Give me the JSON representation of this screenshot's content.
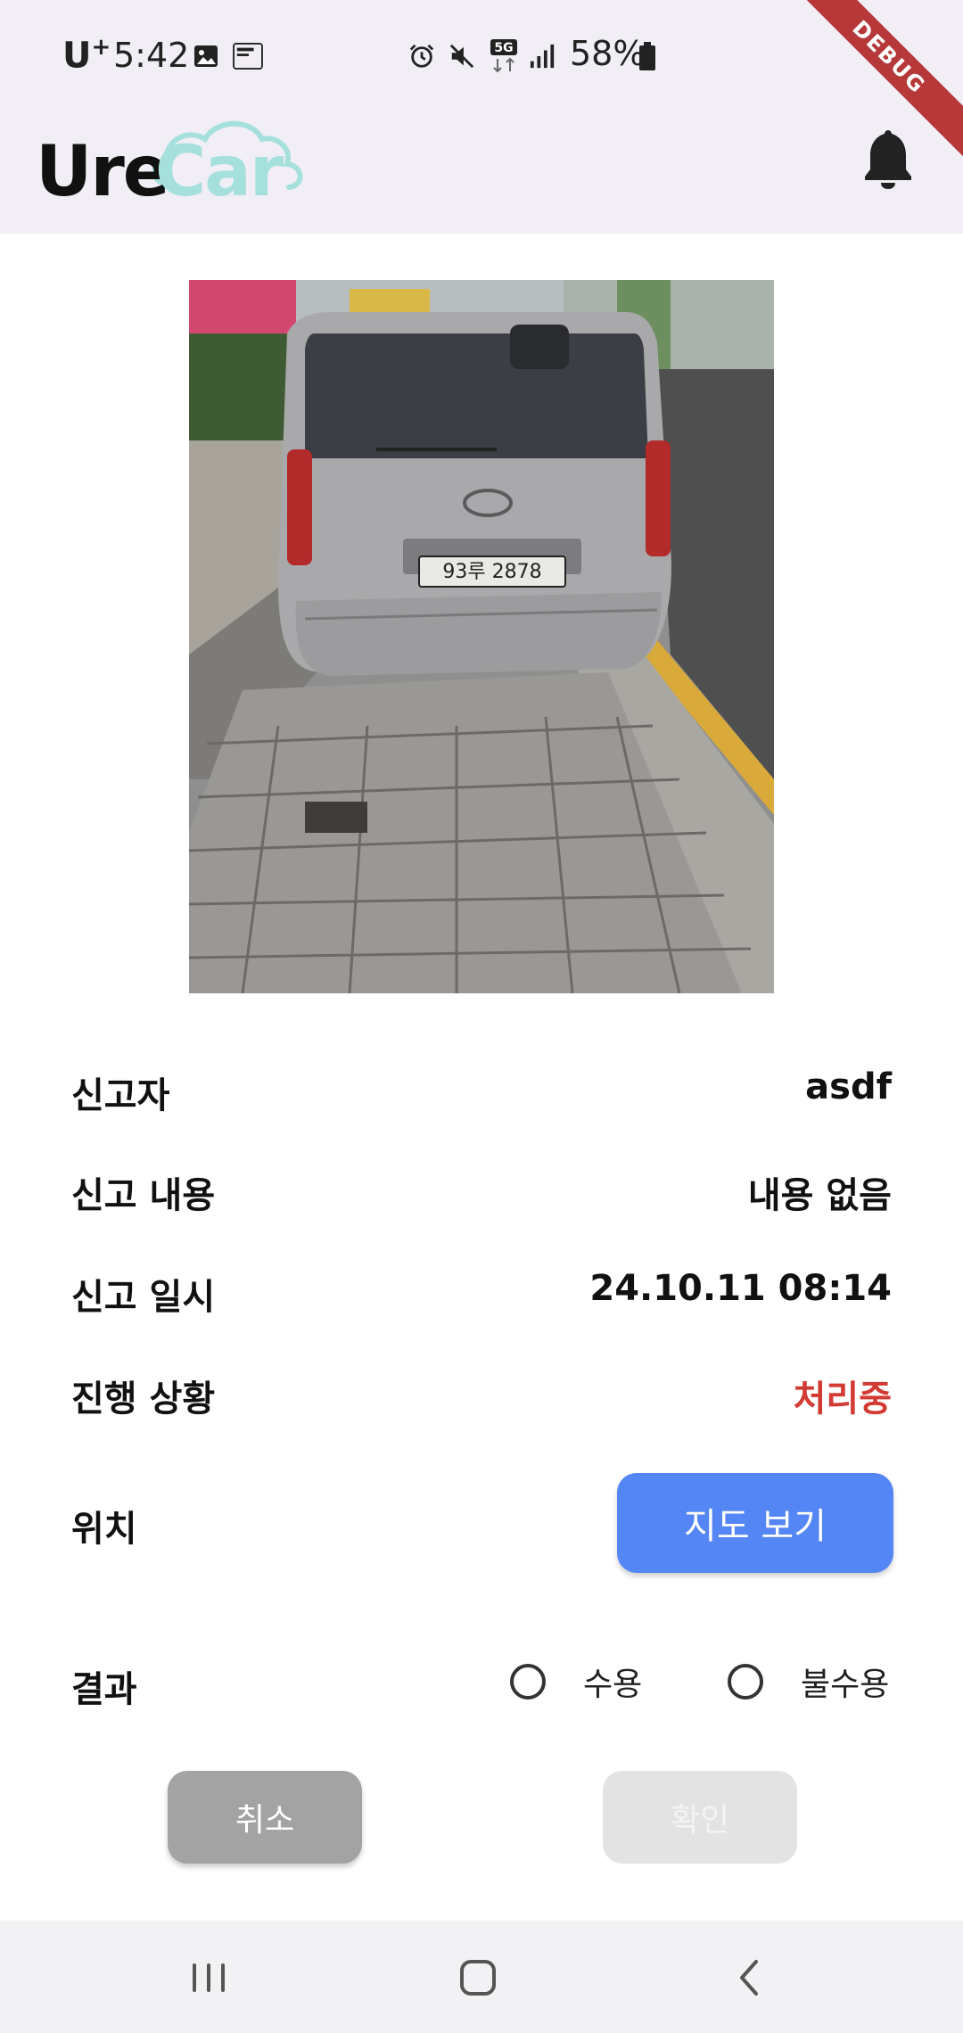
{
  "status_bar": {
    "carrier": "U",
    "carrier_sup": "+",
    "time": "5:42",
    "network": "5G",
    "battery": "58%"
  },
  "debug_banner": "DEBUG",
  "app_bar": {
    "logo_part1": "Ure",
    "logo_part2": "Car",
    "logo_colors": {
      "ure": "#111111",
      "car": "#a6e0dd"
    }
  },
  "report": {
    "photo_plate_text": "93루 2878",
    "fields": [
      {
        "label": "신고자",
        "value": "asdf"
      },
      {
        "label": "신고 내용",
        "value": "내용 없음"
      },
      {
        "label": "신고 일시",
        "value": "24.10.11 08:14"
      },
      {
        "label": "진행 상황",
        "value": "처리중",
        "value_color": "#d13b33"
      }
    ],
    "location_label": "위치",
    "map_button": "지도 보기",
    "result_label": "결과",
    "result_options": [
      {
        "label": "수용",
        "selected": false
      },
      {
        "label": "불수용",
        "selected": false
      }
    ]
  },
  "actions": {
    "cancel": "취소",
    "confirm": "확인",
    "confirm_enabled": false
  },
  "colors": {
    "accent": "#5586f5",
    "status_red": "#d13b33",
    "app_bar_bg": "#f1eff5"
  }
}
